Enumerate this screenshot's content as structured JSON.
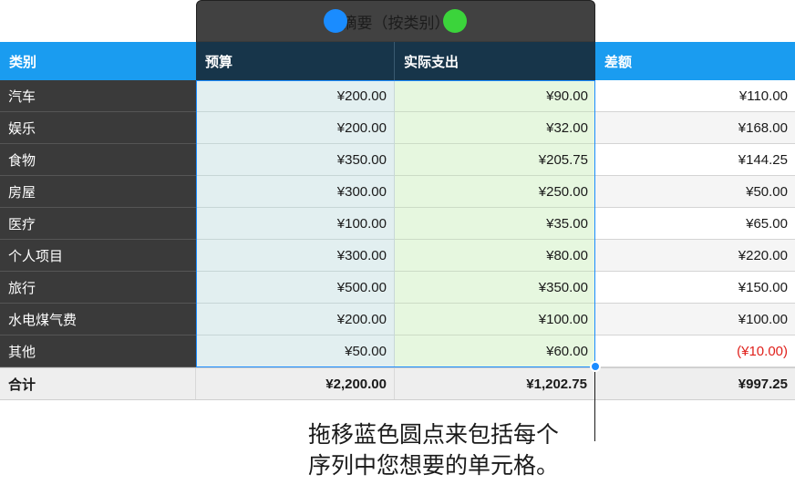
{
  "table": {
    "title": "摘要（按类别）",
    "headers": [
      "类别",
      "预算",
      "实际支出",
      "差额"
    ],
    "rows": [
      {
        "category": "汽车",
        "budget": "¥200.00",
        "actual": "¥90.00",
        "difference": "¥110.00"
      },
      {
        "category": "娱乐",
        "budget": "¥200.00",
        "actual": "¥32.00",
        "difference": "¥168.00"
      },
      {
        "category": "食物",
        "budget": "¥350.00",
        "actual": "¥205.75",
        "difference": "¥144.25"
      },
      {
        "category": "房屋",
        "budget": "¥300.00",
        "actual": "¥250.00",
        "difference": "¥50.00"
      },
      {
        "category": "医疗",
        "budget": "¥100.00",
        "actual": "¥35.00",
        "difference": "¥65.00"
      },
      {
        "category": "个人项目",
        "budget": "¥300.00",
        "actual": "¥80.00",
        "difference": "¥220.00"
      },
      {
        "category": "旅行",
        "budget": "¥500.00",
        "actual": "¥350.00",
        "difference": "¥150.00"
      },
      {
        "category": "水电煤气费",
        "budget": "¥200.00",
        "actual": "¥100.00",
        "difference": "¥100.00"
      },
      {
        "category": "其他",
        "budget": "¥50.00",
        "actual": "¥60.00",
        "difference": "(¥10.00)"
      }
    ],
    "footer": {
      "label": "合计",
      "budget": "¥2,200.00",
      "actual": "¥1,202.75",
      "difference": "¥997.25"
    }
  },
  "callout": {
    "text": "拖移蓝色圆点来包括每个\n序列中您想要的单元格。"
  },
  "colors": {
    "header_blue": "#1a9cf0",
    "header_dark": "#17354a",
    "selection_blue": "#1a8cff",
    "handle_green": "#3bd43b",
    "negative_red": "#e0211c"
  }
}
